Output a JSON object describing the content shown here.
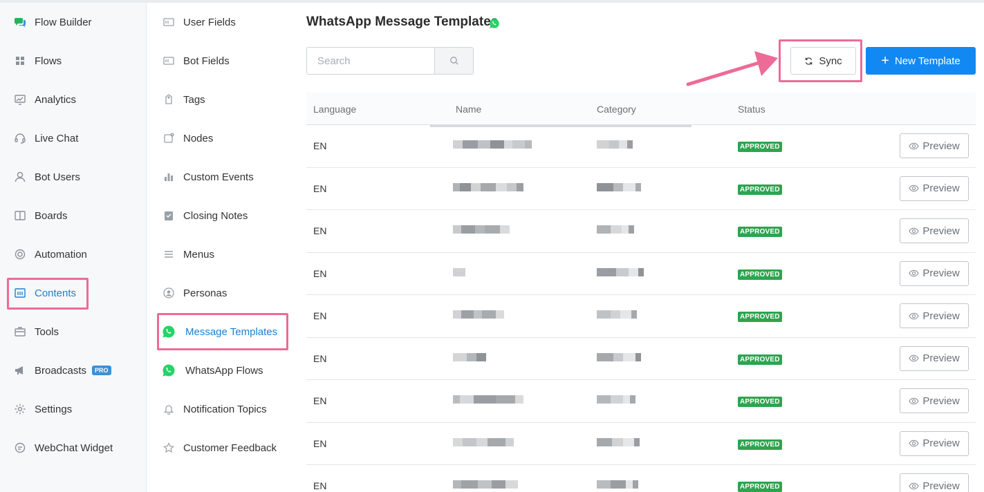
{
  "sidebar": {
    "items": [
      {
        "label": "Flow Builder",
        "icon": "chat-bubbles-icon"
      },
      {
        "label": "Flows",
        "icon": "grid-icon"
      },
      {
        "label": "Analytics",
        "icon": "analytics-icon"
      },
      {
        "label": "Live Chat",
        "icon": "headset-icon"
      },
      {
        "label": "Bot Users",
        "icon": "user-icon"
      },
      {
        "label": "Boards",
        "icon": "board-icon"
      },
      {
        "label": "Automation",
        "icon": "automation-icon"
      },
      {
        "label": "Contents",
        "icon": "contents-icon",
        "active": true
      },
      {
        "label": "Tools",
        "icon": "toolbox-icon"
      },
      {
        "label": "Broadcasts",
        "icon": "megaphone-icon",
        "badge": "PRO"
      },
      {
        "label": "Settings",
        "icon": "gear-icon"
      },
      {
        "label": "WebChat Widget",
        "icon": "webchat-icon"
      }
    ]
  },
  "subnav": {
    "items": [
      {
        "label": "User Fields",
        "icon": "field-icon"
      },
      {
        "label": "Bot Fields",
        "icon": "field-icon"
      },
      {
        "label": "Tags",
        "icon": "tag-icon"
      },
      {
        "label": "Nodes",
        "icon": "node-icon"
      },
      {
        "label": "Custom Events",
        "icon": "bar-chart-icon"
      },
      {
        "label": "Closing Notes",
        "icon": "clipboard-icon"
      },
      {
        "label": "Menus",
        "icon": "menu-icon"
      },
      {
        "label": "Personas",
        "icon": "persona-icon"
      },
      {
        "label": "Message Templates",
        "icon": "whatsapp-icon",
        "active": true
      },
      {
        "label": "WhatsApp Flows",
        "icon": "whatsapp-icon"
      },
      {
        "label": "Notification Topics",
        "icon": "bell-icon"
      },
      {
        "label": "Customer Feedback",
        "icon": "star-icon"
      }
    ]
  },
  "main": {
    "title": "WhatsApp Message Templates",
    "search_placeholder": "Search",
    "sync_label": "Sync",
    "new_template_label": "New Template"
  },
  "table": {
    "headers": {
      "language": "Language",
      "name": "Name",
      "category": "Category",
      "status": "Status"
    },
    "preview_label": "Preview",
    "rows": [
      {
        "language": "EN",
        "status": "APPROVED"
      },
      {
        "language": "EN",
        "status": "APPROVED"
      },
      {
        "language": "EN",
        "status": "APPROVED"
      },
      {
        "language": "EN",
        "status": "APPROVED"
      },
      {
        "language": "EN",
        "status": "APPROVED"
      },
      {
        "language": "EN",
        "status": "APPROVED"
      },
      {
        "language": "EN",
        "status": "APPROVED"
      },
      {
        "language": "EN",
        "status": "APPROVED"
      },
      {
        "language": "EN",
        "status": "APPROVED"
      }
    ]
  },
  "colors": {
    "accent": "#1289f2",
    "highlight": "#ec6b97",
    "approved": "#2ea44f",
    "whatsapp": "#25d366"
  }
}
